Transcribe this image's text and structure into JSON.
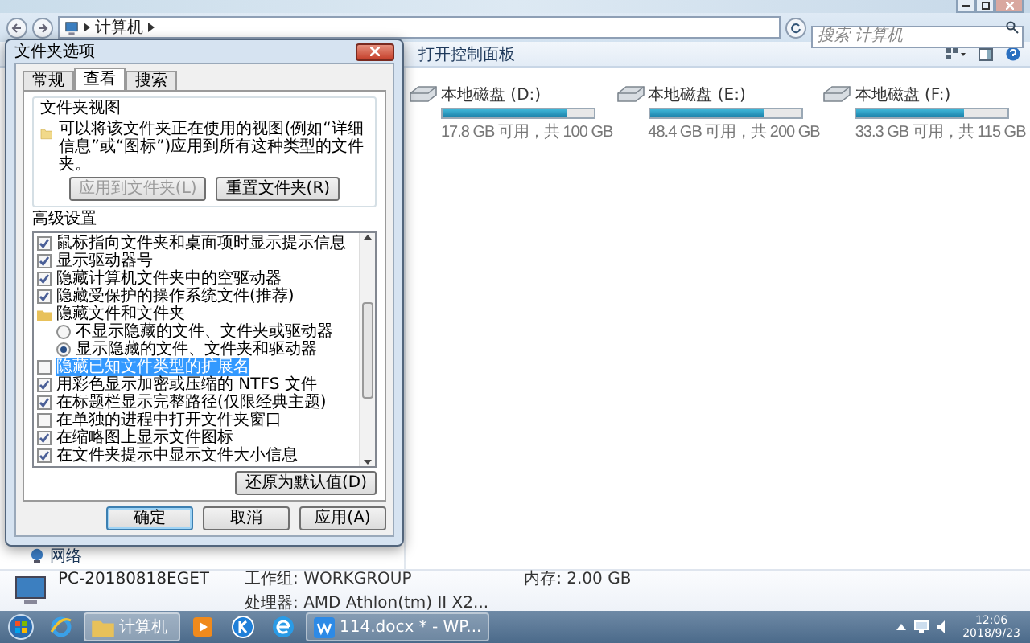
{
  "window": {
    "address": "计算机",
    "search": {
      "placeholder": "搜索 计算机"
    },
    "toolbar": [
      "打开控制面板"
    ]
  },
  "navigation": [
    {
      "label": "网络"
    }
  ],
  "drives": [
    {
      "name": "本地磁盘 (D:)",
      "level": 0.82,
      "space": "17.8 GB 可用，共 100 GB"
    },
    {
      "name": "本地磁盘 (E:)",
      "level": 0.76,
      "space": "48.4 GB 可用，共 200 GB"
    },
    {
      "name": "本地磁盘 (F:)",
      "level": 0.71,
      "space": "33.3 GB 可用，共 115 GB"
    }
  ],
  "details": {
    "computer": "PC-20180818EGET",
    "fields": [
      {
        "label": "工作组:",
        "value": "WORKGROUP"
      },
      {
        "label": "内存:",
        "value": "2.00 GB"
      },
      {
        "label": "处理器:",
        "value": "AMD Athlon(tm) II X2..."
      }
    ]
  },
  "dialog": {
    "title": "文件夹选项",
    "tabs": [
      {
        "label": "常规",
        "selected": false
      },
      {
        "label": "查看",
        "selected": true
      },
      {
        "label": "搜索",
        "selected": false
      }
    ],
    "folder_views": {
      "heading": "文件夹视图",
      "description": "可以将该文件夹正在使用的视图(例如“详细信息”或“图标”)应用到所有这种类型的文件夹。",
      "buttons": [
        {
          "label": "应用到文件夹(L)",
          "disabled": true
        },
        {
          "label": "重置文件夹(R)",
          "disabled": false
        }
      ]
    },
    "advanced": {
      "heading": "高级设置",
      "items": [
        {
          "kind": "checkbox",
          "label": "鼠标指向文件夹和桌面项时显示提示信息",
          "checked": true,
          "selected": false
        },
        {
          "kind": "checkbox",
          "label": "显示驱动器号",
          "checked": true,
          "selected": false
        },
        {
          "kind": "checkbox",
          "label": "隐藏计算机文件夹中的空驱动器",
          "checked": true,
          "selected": false
        },
        {
          "kind": "checkbox",
          "label": "隐藏受保护的操作系统文件(推荐)",
          "checked": true,
          "selected": false
        },
        {
          "kind": "group",
          "label": "隐藏文件和文件夹",
          "selected": false,
          "children": [
            {
              "kind": "radio",
              "label": "不显示隐藏的文件、文件夹或驱动器",
              "checked": false,
              "selected": false
            },
            {
              "kind": "radio",
              "label": "显示隐藏的文件、文件夹和驱动器",
              "checked": true,
              "selected": false
            }
          ]
        },
        {
          "kind": "checkbox",
          "label": "隐藏已知文件类型的扩展名",
          "checked": false,
          "selected": true
        },
        {
          "kind": "checkbox",
          "label": "用彩色显示加密或压缩的 NTFS 文件",
          "checked": true,
          "selected": false
        },
        {
          "kind": "checkbox",
          "label": "在标题栏显示完整路径(仅限经典主题)",
          "checked": true,
          "selected": false
        },
        {
          "kind": "checkbox",
          "label": "在单独的进程中打开文件夹窗口",
          "checked": false,
          "selected": false
        },
        {
          "kind": "checkbox",
          "label": "在缩略图上显示文件图标",
          "checked": true,
          "selected": false
        },
        {
          "kind": "checkbox",
          "label": "在文件夹提示中显示文件大小信息",
          "checked": true,
          "selected": false
        }
      ]
    },
    "restore_button": "还原为默认值(D)",
    "buttons": [
      {
        "label": "确定",
        "default": true
      },
      {
        "label": "取消",
        "default": false
      },
      {
        "label": "应用(A)",
        "default": false
      }
    ]
  },
  "taskbar": {
    "items": [
      {
        "kind": "browser"
      },
      {
        "kind": "folder",
        "label": "计算机"
      },
      {
        "kind": "media"
      },
      {
        "kind": "k-app"
      },
      {
        "kind": "e-browser"
      },
      {
        "kind": "document",
        "label": "114.docx * - WP..."
      }
    ],
    "clock": {
      "time": "12:06",
      "date": "2018/9/23"
    }
  }
}
